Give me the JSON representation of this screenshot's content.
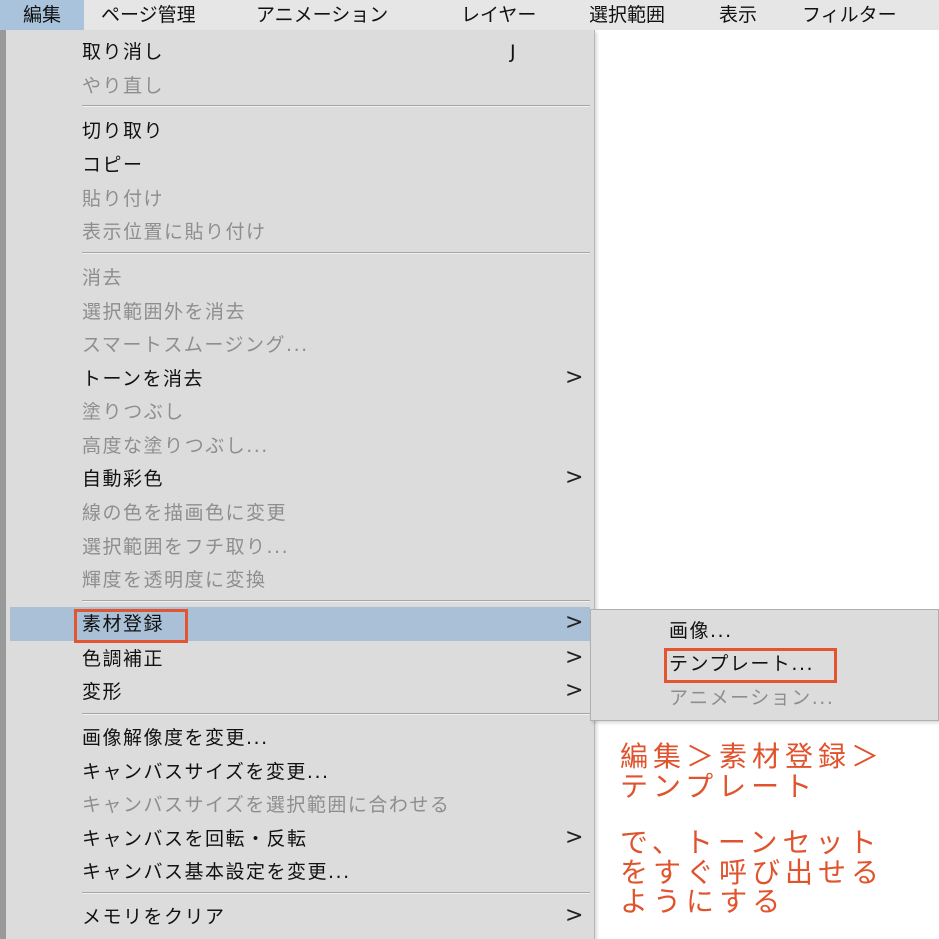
{
  "menubar": {
    "items": [
      "編集",
      "ページ管理",
      "アニメーション",
      "レイヤー",
      "選択範囲",
      "表示",
      "フィルター"
    ]
  },
  "menu": {
    "items": [
      {
        "label": "取り消し",
        "shortcut": "J",
        "enabled": true
      },
      {
        "label": "やり直し",
        "enabled": false
      },
      {
        "label": "切り取り",
        "enabled": true
      },
      {
        "label": "コピー",
        "enabled": true
      },
      {
        "label": "貼り付け",
        "enabled": false
      },
      {
        "label": "表示位置に貼り付け",
        "enabled": false
      },
      {
        "label": "消去",
        "enabled": false
      },
      {
        "label": "選択範囲外を消去",
        "enabled": false
      },
      {
        "label": "スマートスムージング...",
        "enabled": false
      },
      {
        "label": "トーンを消去",
        "enabled": true,
        "submenu": true
      },
      {
        "label": "塗りつぶし",
        "enabled": false
      },
      {
        "label": "高度な塗りつぶし...",
        "enabled": false
      },
      {
        "label": "自動彩色",
        "enabled": true,
        "submenu": true
      },
      {
        "label": "線の色を描画色に変更",
        "enabled": false
      },
      {
        "label": "選択範囲をフチ取り...",
        "enabled": false
      },
      {
        "label": "輝度を透明度に変換",
        "enabled": false
      },
      {
        "label": "素材登録",
        "enabled": true,
        "submenu": true,
        "highlighted": true
      },
      {
        "label": "色調補正",
        "enabled": true,
        "submenu": true
      },
      {
        "label": "変形",
        "enabled": true,
        "submenu": true
      },
      {
        "label": "画像解像度を変更...",
        "enabled": true
      },
      {
        "label": "キャンバスサイズを変更...",
        "enabled": true
      },
      {
        "label": "キャンバスサイズを選択範囲に合わせる",
        "enabled": false
      },
      {
        "label": "キャンバスを回転・反転",
        "enabled": true,
        "submenu": true
      },
      {
        "label": "キャンバス基本設定を変更...",
        "enabled": true
      },
      {
        "label": "メモリをクリア",
        "enabled": true,
        "submenu": true
      }
    ],
    "submenu_arrow": ">"
  },
  "submenu": {
    "items": [
      {
        "label": "画像...",
        "enabled": true
      },
      {
        "label": "テンプレート...",
        "enabled": true
      },
      {
        "label": "アニメーション...",
        "enabled": false
      }
    ]
  },
  "annotation": {
    "lines": [
      "編集＞素材登録＞",
      "テンプレート",
      "で、トーンセット",
      "をすぐ呼び出せる",
      "ようにする"
    ],
    "color": "#e0532c"
  }
}
